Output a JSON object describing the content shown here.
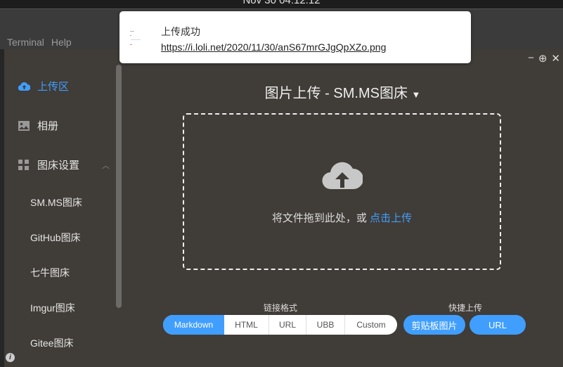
{
  "system": {
    "clock": "Nov 30 04:12:12"
  },
  "terminal_menu": [
    "Terminal",
    "Help"
  ],
  "notification": {
    "title": "上传成功",
    "url": "https://i.loli.net/2020/11/30/anS67mrGJgQpXZo.png"
  },
  "window_controls": {
    "minimize": "−",
    "maximize": "⊕",
    "close": "✕"
  },
  "sidebar": {
    "items": [
      {
        "label": "上传区",
        "icon": "cloud-upload-icon"
      },
      {
        "label": "相册",
        "icon": "image-icon"
      },
      {
        "label": "图床设置",
        "icon": "grid-icon"
      }
    ],
    "sub_items": [
      "SM.MS图床",
      "GitHub图床",
      "七牛图床",
      "Imgur图床",
      "Gitee图床"
    ]
  },
  "main": {
    "title": "图片上传 - SM.MS图床",
    "drop_text": "将文件拖到此处，或 ",
    "drop_link": "点击上传",
    "link_format_label": "链接格式",
    "formats": [
      "Markdown",
      "HTML",
      "URL",
      "UBB",
      "Custom"
    ],
    "selected_format": "Markdown",
    "quick_upload_label": "快捷上传",
    "quick_buttons": [
      "剪贴板图片",
      "URL"
    ]
  },
  "colors": {
    "accent": "#409eff",
    "bg": "#403c37"
  }
}
